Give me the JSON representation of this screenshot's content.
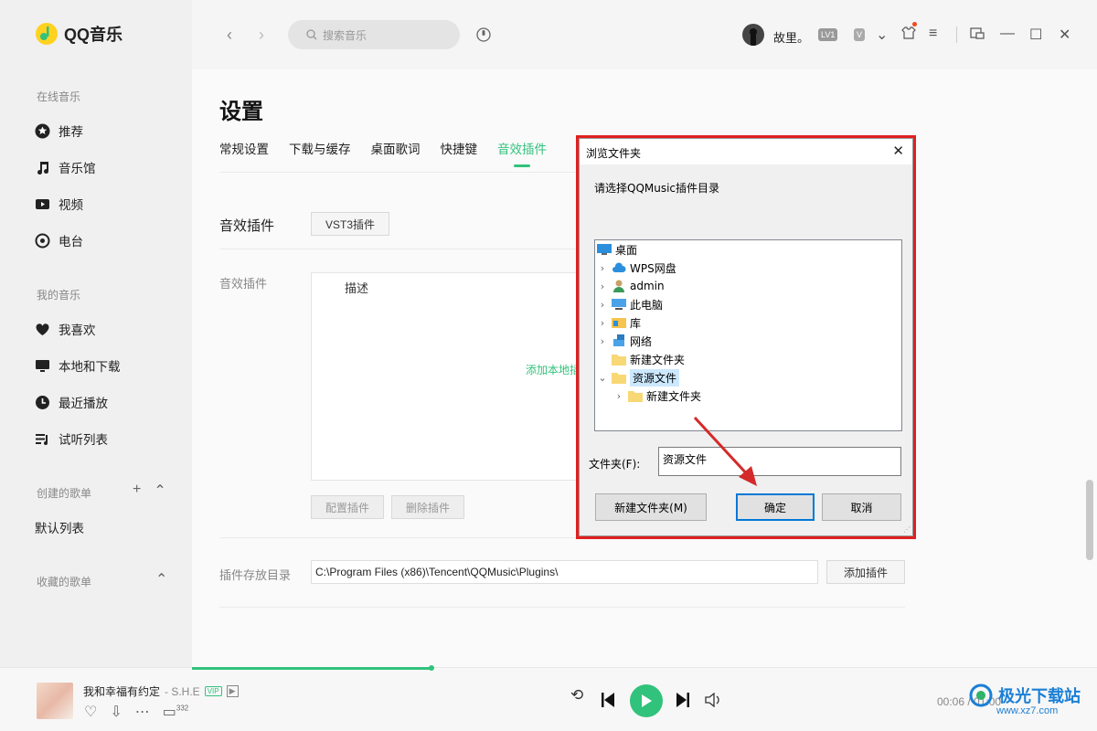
{
  "app": {
    "name": "QQ音乐"
  },
  "sidebar": {
    "online_title": "在线音乐",
    "online_items": [
      {
        "label": "推荐"
      },
      {
        "label": "音乐馆"
      },
      {
        "label": "视频"
      },
      {
        "label": "电台"
      }
    ],
    "my_title": "我的音乐",
    "my_items": [
      {
        "label": "我喜欢"
      },
      {
        "label": "本地和下载"
      },
      {
        "label": "最近播放"
      },
      {
        "label": "试听列表"
      }
    ],
    "created_title": "创建的歌单",
    "created_items": [
      {
        "label": "默认列表"
      }
    ],
    "collected_title": "收藏的歌单"
  },
  "topbar": {
    "search_placeholder": "搜索音乐",
    "username": "故里。",
    "badges": [
      "LV1",
      "V"
    ]
  },
  "settings": {
    "title": "设置",
    "tabs": [
      {
        "label": "常规设置",
        "active": false
      },
      {
        "label": "下载与缓存",
        "active": false
      },
      {
        "label": "桌面歌词",
        "active": false
      },
      {
        "label": "快捷键",
        "active": false
      },
      {
        "label": "音效插件",
        "active": true
      }
    ],
    "section_label": "音效插件",
    "vst3_button": "VST3插件",
    "plugin_list_label": "音效插件",
    "column_desc": "描述",
    "add_local_text": "添加本地插",
    "config_button": "配置插件",
    "delete_button": "删除插件",
    "plugin_dir_label": "插件存放目录",
    "plugin_dir_value": "C:\\Program Files (x86)\\Tencent\\QQMusic\\Plugins\\",
    "add_plugin_button": "添加插件"
  },
  "player": {
    "song": "我和幸福有约定",
    "artist": "- S.H.E",
    "vip": "VIP",
    "comment_count": "332",
    "time": "00:06 / 01:00"
  },
  "dialog": {
    "title": "浏览文件夹",
    "prompt": "请选择QQMusic插件目录",
    "tree": [
      {
        "label": "桌面",
        "level": 0,
        "icon": "desktop-icon",
        "expander": "",
        "selected": false
      },
      {
        "label": "WPS网盘",
        "level": 1,
        "icon": "cloud-icon",
        "expander": "›",
        "selected": false
      },
      {
        "label": "admin",
        "level": 1,
        "icon": "user-icon",
        "expander": "›",
        "selected": false
      },
      {
        "label": "此电脑",
        "level": 1,
        "icon": "computer-icon",
        "expander": "›",
        "selected": false
      },
      {
        "label": "库",
        "level": 1,
        "icon": "library-icon",
        "expander": "›",
        "selected": false
      },
      {
        "label": "网络",
        "level": 1,
        "icon": "network-icon",
        "expander": "›",
        "selected": false
      },
      {
        "label": "新建文件夹",
        "level": 1,
        "icon": "folder-icon",
        "expander": "",
        "selected": false
      },
      {
        "label": "资源文件",
        "level": 1,
        "icon": "folder-icon",
        "expander": "⌄",
        "selected": true
      },
      {
        "label": "新建文件夹",
        "level": 2,
        "icon": "folder-icon",
        "expander": "›",
        "selected": false
      }
    ],
    "folder_label": "文件夹(F):",
    "folder_value": "资源文件",
    "new_folder_button": "新建文件夹(M)",
    "ok_button": "确定",
    "cancel_button": "取消"
  },
  "watermark": {
    "title": "极光下载站",
    "url": "www.xz7.com"
  },
  "colors": {
    "accent": "#31c27c",
    "highlight_border": "#e02020",
    "arrow": "#d42a2a"
  }
}
